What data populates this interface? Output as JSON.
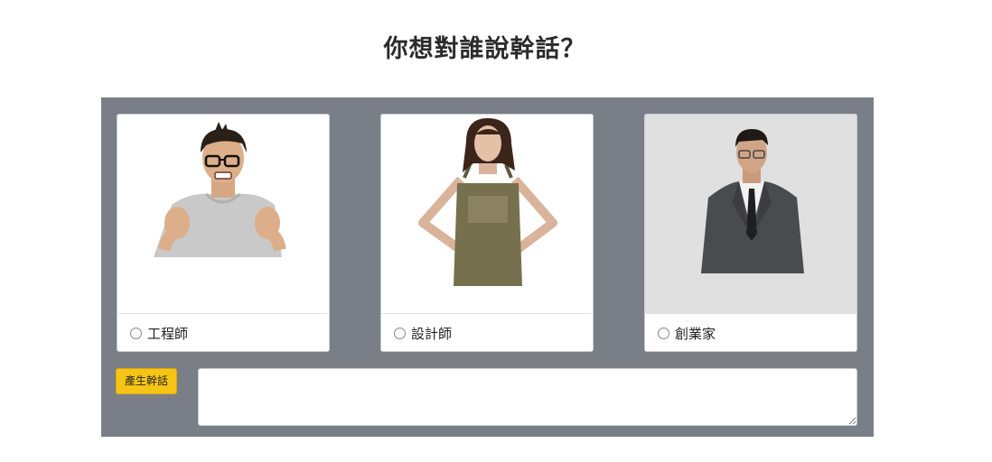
{
  "title": "你想對誰說幹話？",
  "options": [
    {
      "label": "工程師",
      "icon": "engineer-photo"
    },
    {
      "label": "設計師",
      "icon": "designer-photo"
    },
    {
      "label": "創業家",
      "icon": "entrepreneur-photo"
    }
  ],
  "generate_button": "產生幹話",
  "output": {
    "value": "",
    "placeholder": ""
  },
  "colors": {
    "panel": "#7a7f87",
    "button": "#f5c415"
  }
}
